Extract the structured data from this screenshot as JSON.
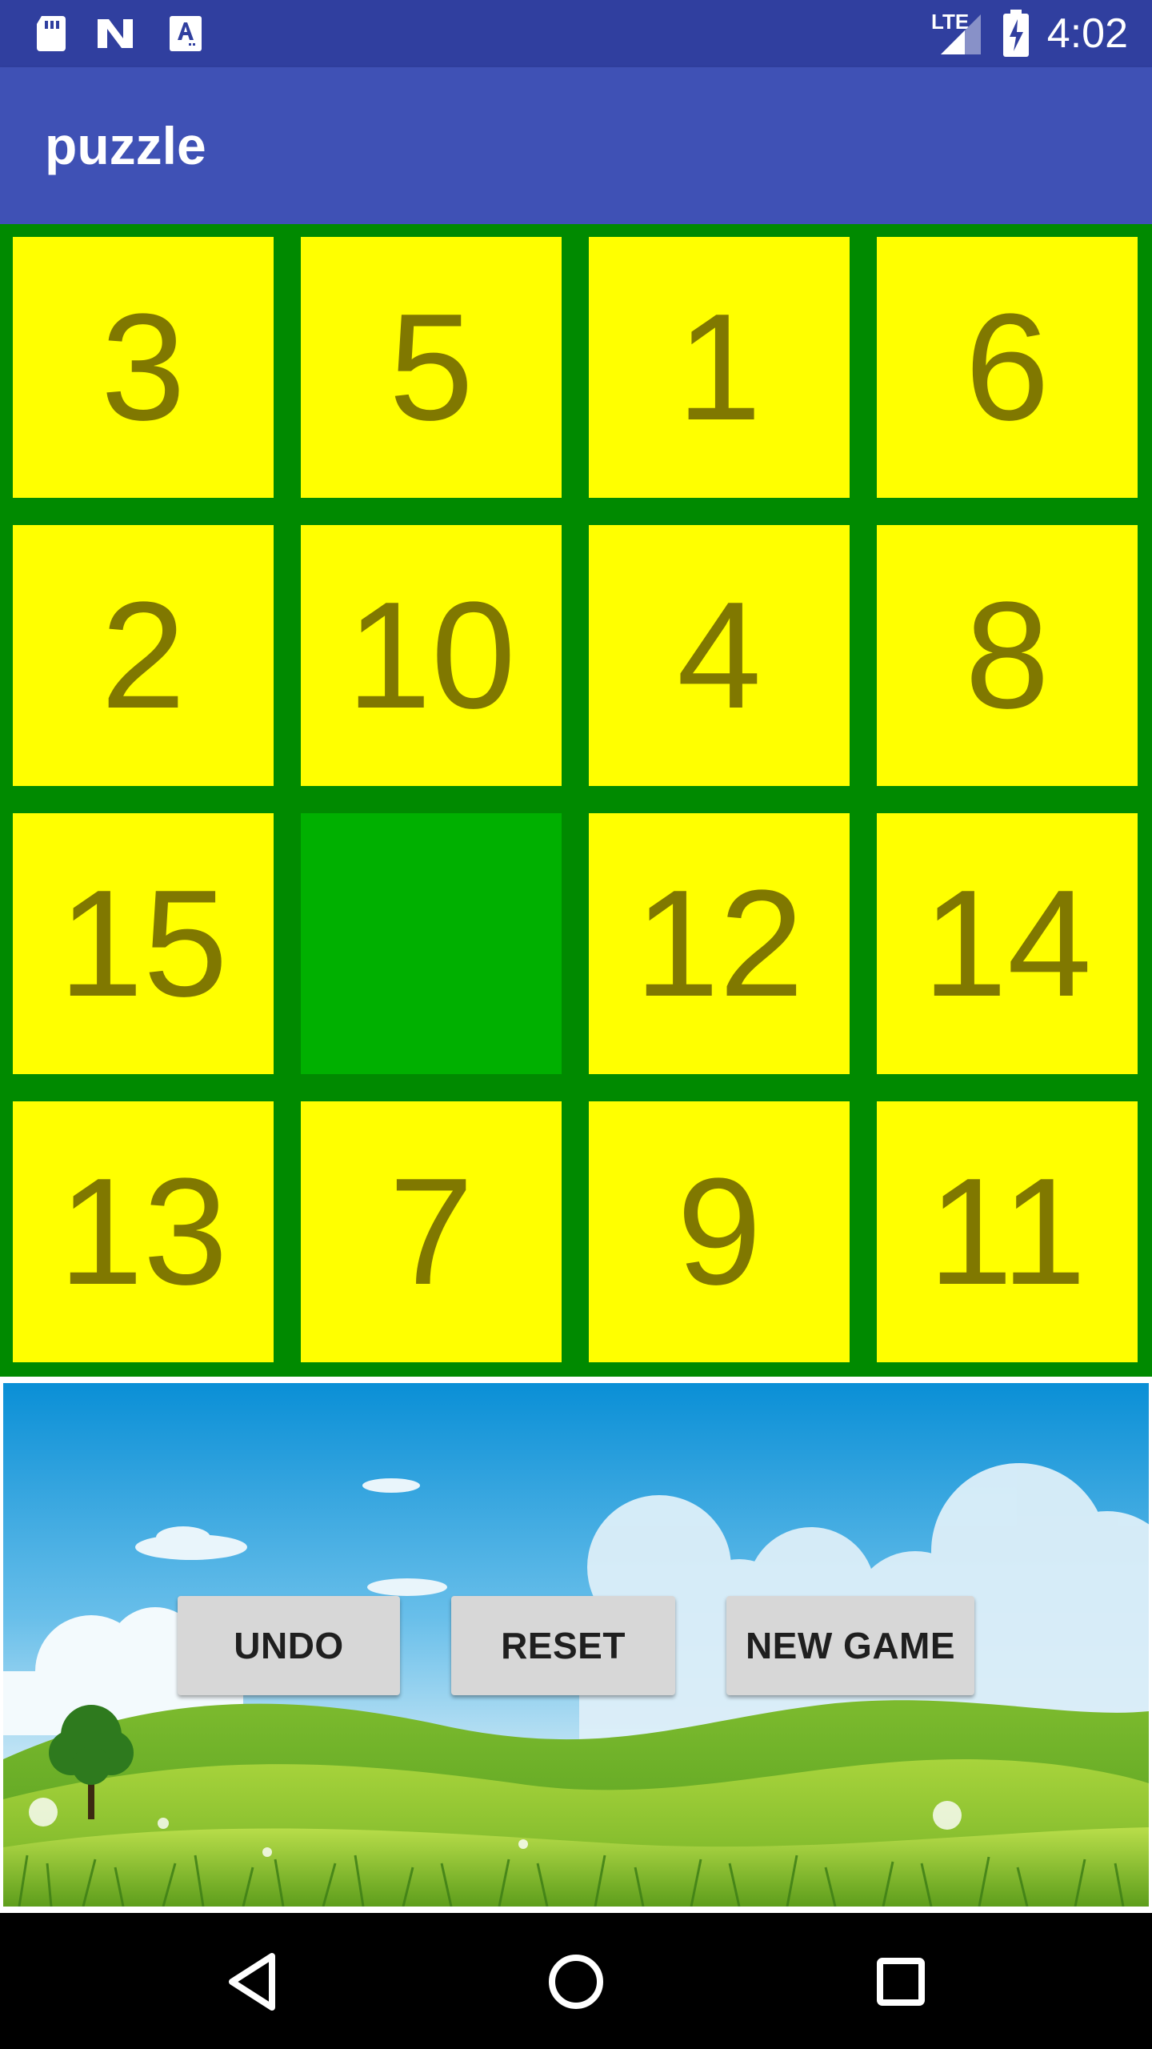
{
  "status_bar": {
    "time": "4:02",
    "network_label": "LTE",
    "icons": [
      "sd-card-icon",
      "n-logo-icon",
      "font-a-icon",
      "lte-signal-icon",
      "battery-charging-icon"
    ]
  },
  "app_bar": {
    "title": "puzzle",
    "color": "#3F51B5"
  },
  "board": {
    "rows": 4,
    "cols": 4,
    "tiles": [
      "3",
      "5",
      "1",
      "6",
      "2",
      "10",
      "4",
      "8",
      "15",
      "",
      "12",
      "14",
      "13",
      "7",
      "9",
      "11"
    ],
    "empty_index": 9,
    "tile_color": "#FFFF00",
    "tile_text_color": "#807800",
    "empty_color": "#00B000",
    "border_color": "#008A00"
  },
  "controls": {
    "undo_label": "UNDO",
    "reset_label": "RESET",
    "new_game_label": "NEW GAME"
  },
  "nav_bar": {
    "icons": [
      "back-icon",
      "home-icon",
      "recents-icon"
    ]
  }
}
